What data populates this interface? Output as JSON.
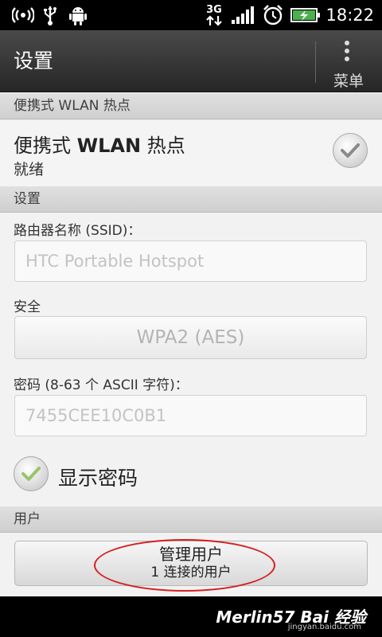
{
  "status_bar": {
    "network_label": "3G",
    "time": "18:22",
    "icons": [
      "wifi-hotspot-icon",
      "usb-icon",
      "android-debug-icon",
      "network-3g-icon",
      "signal-icon",
      "alarm-icon",
      "battery-charging-icon"
    ]
  },
  "title_bar": {
    "title": "设置",
    "menu_label": "菜单"
  },
  "hotspot_section": {
    "header": "便携式 WLAN 热点",
    "item_title_prefix": "便携式 ",
    "item_title_bold": "WLAN",
    "item_title_suffix": " 热点",
    "item_status": "就绪",
    "checked": true
  },
  "settings_section": {
    "header": "设置",
    "ssid_label": "路由器名称 (SSID)：",
    "ssid_value": "HTC Portable Hotspot",
    "security_label": "安全",
    "security_value": "WPA2 (AES)",
    "password_label": "密码 (8-63 个 ASCII 字符)：",
    "password_value": "7455CEE10C0B1",
    "show_password_label": "显示密码",
    "show_password_checked": true
  },
  "users_section": {
    "header": "用户",
    "manage_button_title": "管理用户",
    "manage_button_subtitle": "1 连接的用户"
  },
  "watermark": {
    "text": "Merlin57 Bai 经验",
    "url": "jingyan.baidu.com"
  },
  "colors": {
    "status_bar_bg": "#000000",
    "title_bar_bg": "#333333",
    "section_header_bg": "#d8d8d8",
    "body_bg": "#f2f2f2",
    "check_green": "#9ac46a",
    "annotation_red": "#d42020"
  }
}
